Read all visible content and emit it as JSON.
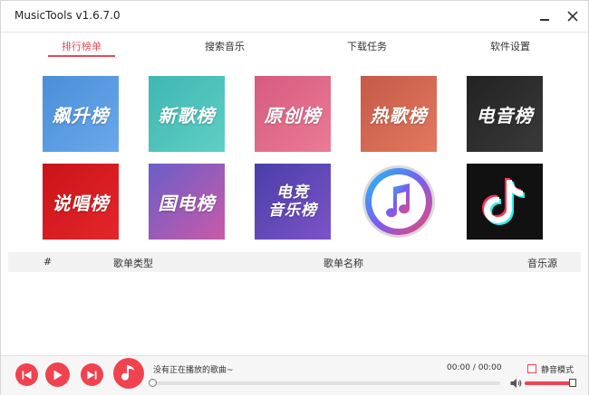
{
  "window": {
    "title": "MusicTools v1.6.7.0"
  },
  "tabs": [
    {
      "label": "排行榜单",
      "active": true
    },
    {
      "label": "搜索音乐",
      "active": false
    },
    {
      "label": "下载任务",
      "active": false
    },
    {
      "label": "软件设置",
      "active": false
    }
  ],
  "charts": [
    {
      "label": "飙升榜",
      "icon": "soaring-chart-cover"
    },
    {
      "label": "新歌榜",
      "icon": "new-songs-chart-cover"
    },
    {
      "label": "原创榜",
      "icon": "original-chart-cover"
    },
    {
      "label": "热歌榜",
      "icon": "hot-songs-chart-cover"
    },
    {
      "label": "电音榜",
      "icon": "electronic-chart-cover"
    },
    {
      "label": "说唱榜",
      "icon": "rap-chart-cover"
    },
    {
      "label": "国电榜",
      "icon": "chinese-electronic-chart-cover"
    },
    {
      "label_line1": "电竞",
      "label_line2": "音乐榜",
      "icon": "esports-music-chart-cover"
    },
    {
      "label": "",
      "icon": "apple-music-icon"
    },
    {
      "label": "",
      "icon": "tiktok-icon"
    }
  ],
  "table": {
    "columns": [
      "#",
      "歌单类型",
      "歌单名称",
      "音乐源"
    ],
    "rows": []
  },
  "player": {
    "now_playing": "没有正在播放的歌曲~",
    "time": "00:00 / 00:00",
    "progress": 0,
    "mute_label": "静音模式",
    "mute_checked": false,
    "volume": 1.0
  },
  "colors": {
    "accent": "#f0424f",
    "tab_active": "#e24a5a"
  }
}
